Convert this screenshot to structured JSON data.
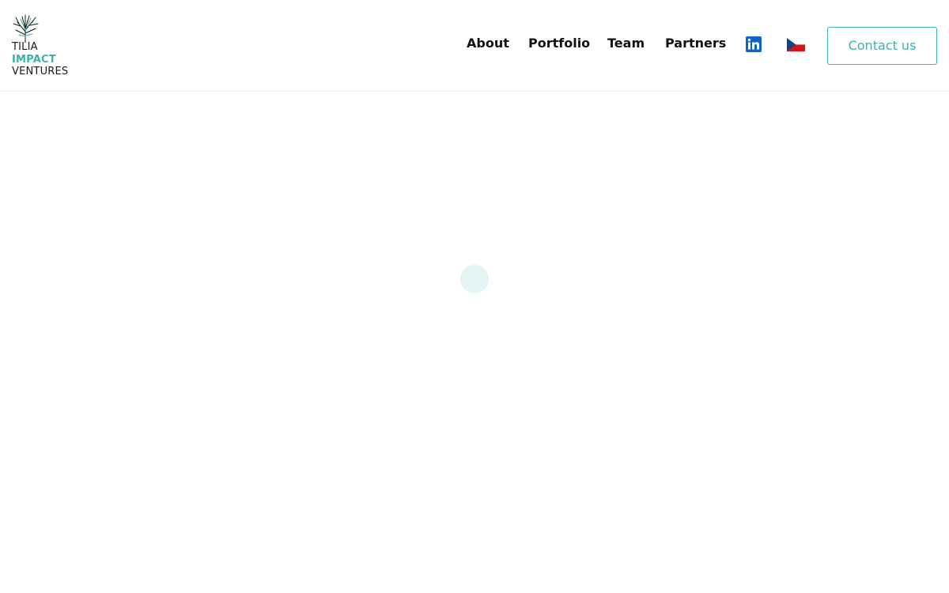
{
  "logo": {
    "line1": "TILIA",
    "line2": "IMPACT",
    "line3": "VENTURES",
    "icon": "tree-icon",
    "colors": {
      "dark": "#1a1a1a",
      "accent": "#3fb0ac"
    }
  },
  "nav": {
    "items": [
      {
        "label": "About"
      },
      {
        "label": "Portfolio"
      },
      {
        "label": "Team"
      },
      {
        "label": "Partners"
      }
    ],
    "linkedin_icon": "linkedin-icon",
    "language_icon": "czech-flag-icon",
    "contact_label": "Contact us"
  },
  "main": {
    "loader_icon": "loading-spinner-icon"
  },
  "colors": {
    "accent": "#3fb0ac",
    "loader": "#e4f3f4",
    "linkedin": "#0a66c2"
  }
}
